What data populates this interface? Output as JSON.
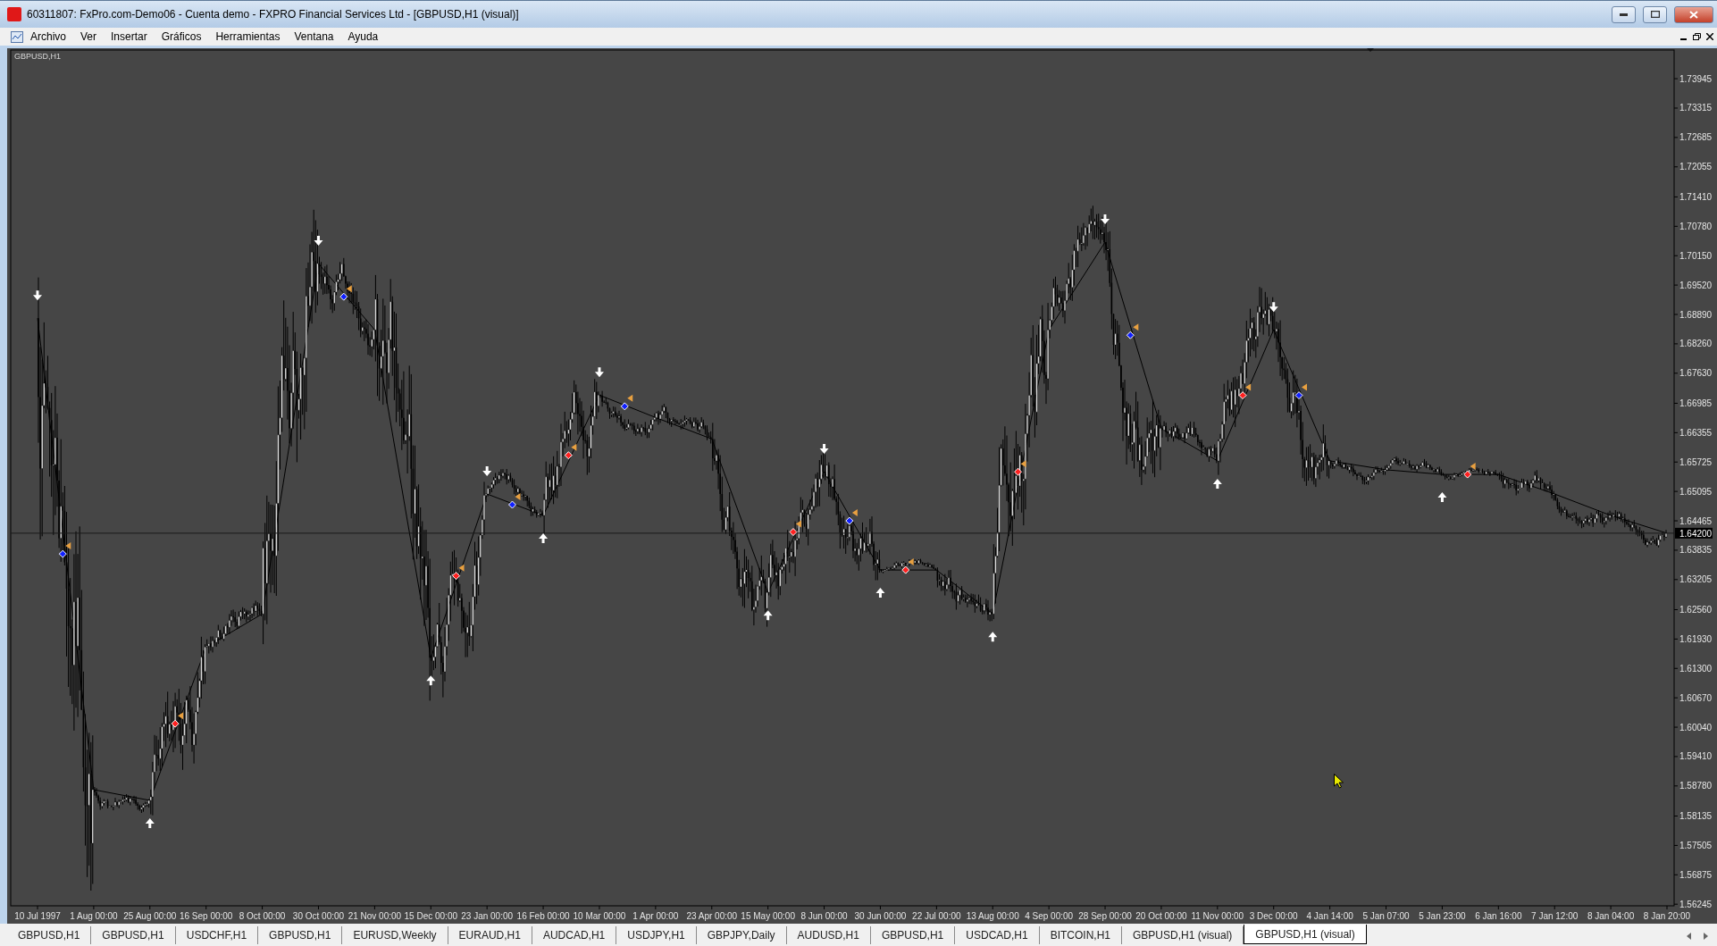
{
  "window": {
    "title": "60311807: FxPro.com-Demo06 - Cuenta demo - FXPRO Financial Services Ltd - [GBPUSD,H1 (visual)]"
  },
  "menu": [
    "Archivo",
    "Ver",
    "Insertar",
    "Gráficos",
    "Herramientas",
    "Ventana",
    "Ayuda"
  ],
  "chart": {
    "current_price": "1.64200",
    "chart_data": {
      "type": "line",
      "x": [
        "10 Jul 1997",
        "1 Aug 00:00",
        "25 Aug 00:00",
        "16 Sep 00:00",
        "8 Oct 00:00",
        "30 Oct 00:00",
        "21 Nov 00:00",
        "15 Dec 00:00",
        "23 Jan 00:00",
        "16 Feb 00:00",
        "10 Mar 00:00",
        "1 Apr 00:00",
        "23 Apr 00:00",
        "15 May 00:00",
        "8 Jun 00:00",
        "30 Jun 00:00",
        "22 Jul 00:00",
        "13 Aug 00:00",
        "4 Sep 00:00",
        "28 Sep 00:00",
        "20 Oct 00:00",
        "11 Nov 00:00",
        "3 Dec 00:00",
        "4 Jan 14:00",
        "5 Jan 07:00",
        "5 Jan 23:00",
        "6 Jan 16:00",
        "7 Jan 12:00",
        "8 Jan 04:00",
        "8 Jan 20:00"
      ],
      "series": [
        {
          "name": "GBPUSD,H1",
          "color": "#000000",
          "values": [
            1.6881,
            1.587,
            1.5847,
            1.6176,
            1.6247,
            1.6998,
            1.6856,
            1.6153,
            1.6504,
            1.6458,
            1.6716,
            1.6668,
            1.6622,
            1.6293,
            1.6552,
            1.6341,
            1.6341,
            1.6247,
            1.6856,
            1.7044,
            1.6645,
            1.6575,
            1.6856,
            1.6575,
            1.6556,
            1.6546,
            1.6546,
            1.6504,
            1.6458,
            1.642
          ]
        }
      ],
      "ylim": [
        1.5621,
        1.7456
      ],
      "yticks": [
        {
          "value": 1.73945,
          "label": "1.73945"
        },
        {
          "value": 1.73315,
          "label": "1.73315"
        },
        {
          "value": 1.72685,
          "label": "1.72685"
        },
        {
          "value": 1.72055,
          "label": "1.72055"
        },
        {
          "value": 1.7141,
          "label": "1.71410"
        },
        {
          "value": 1.7078,
          "label": "1.70780"
        },
        {
          "value": 1.7015,
          "label": "1.70150"
        },
        {
          "value": 1.6952,
          "label": "1.69520"
        },
        {
          "value": 1.6889,
          "label": "1.68890"
        },
        {
          "value": 1.6826,
          "label": "1.68260"
        },
        {
          "value": 1.6763,
          "label": "1.67630"
        },
        {
          "value": 1.66985,
          "label": "1.66985"
        },
        {
          "value": 1.66355,
          "label": "1.66355"
        },
        {
          "value": 1.65725,
          "label": "1.65725"
        },
        {
          "value": 1.65095,
          "label": "1.65095"
        },
        {
          "value": 1.64465,
          "label": "1.64465"
        },
        {
          "value": 1.63835,
          "label": "1.63835"
        },
        {
          "value": 1.63205,
          "label": "1.63205"
        },
        {
          "value": 1.6256,
          "label": "1.62560"
        },
        {
          "value": 1.6193,
          "label": "1.61930"
        },
        {
          "value": 1.613,
          "label": "1.61300"
        },
        {
          "value": 1.6067,
          "label": "1.60670"
        },
        {
          "value": 1.6004,
          "label": "1.60040"
        },
        {
          "value": 1.5941,
          "label": "1.59410"
        },
        {
          "value": 1.5878,
          "label": "1.58780"
        },
        {
          "value": 1.58135,
          "label": "1.58135"
        },
        {
          "value": 1.57505,
          "label": "1.57505"
        },
        {
          "value": 1.56875,
          "label": "1.56875"
        },
        {
          "value": 1.56245,
          "label": "1.56245"
        }
      ]
    }
  },
  "tabs": [
    {
      "label": "GBPUSD,H1",
      "selected": false
    },
    {
      "label": "GBPUSD,H1",
      "selected": false
    },
    {
      "label": "USDCHF,H1",
      "selected": false
    },
    {
      "label": "GBPUSD,H1",
      "selected": false
    },
    {
      "label": "EURUSD,Weekly",
      "selected": false
    },
    {
      "label": "EURAUD,H1",
      "selected": false
    },
    {
      "label": "AUDCAD,H1",
      "selected": false
    },
    {
      "label": "USDJPY,H1",
      "selected": false
    },
    {
      "label": "GBPJPY,Daily",
      "selected": false
    },
    {
      "label": "AUDUSD,H1",
      "selected": false
    },
    {
      "label": "GBPUSD,H1",
      "selected": false
    },
    {
      "label": "USDCAD,H1",
      "selected": false
    },
    {
      "label": "BITCOIN,H1",
      "selected": false
    },
    {
      "label": "GBPUSD,H1 (visual)",
      "selected": false
    },
    {
      "label": "GBPUSD,H1 (visual)",
      "selected": true
    }
  ]
}
